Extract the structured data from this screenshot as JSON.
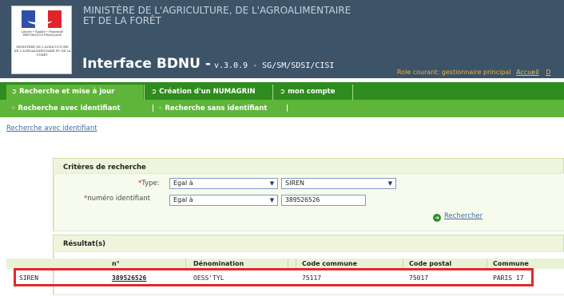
{
  "header": {
    "logo": {
      "republic_text": "Liberté • Égalité • Fraternité RÉPUBLIQUE FRANÇAISE",
      "ministry_text": "MINISTÈRE DE L'AGRICULTURE DE L'AGROALIMENTAIRE ET DE LA FORÊT"
    },
    "ministry_line1": "MINISTÈRE DE L'AGRICULTURE, DE L'AGROALIMENTAIRE",
    "ministry_line2": "ET DE LA FORÊT",
    "app_title": "Interface BDNU -",
    "version": "v.3.0.9 - SG/SM/SDSI/CISI",
    "role": "Role courant: gestionnaire principal",
    "accueil": "Accueil",
    "cut_link": "D"
  },
  "nav": {
    "tabs": [
      {
        "label": "Recherche et mise à jour"
      },
      {
        "label": "Création d'un NUMAGRIN"
      },
      {
        "label": "mon compte"
      }
    ]
  },
  "subnav": {
    "items": [
      {
        "label": "Recherche avec identifiant"
      },
      {
        "label": "Recherche sans identifiant"
      }
    ]
  },
  "breadcrumb": "Recherche avec identifiant",
  "criteria": {
    "title": "Critères de recherche",
    "type_label": "Type:",
    "type_operator": "Egal à",
    "type_value": "SIREN",
    "id_label": "numéro identifiant",
    "id_operator": "Egal à",
    "id_value": "389526526",
    "search_button": "Rechercher"
  },
  "results": {
    "title": "Résultat(s)",
    "columns": [
      "n°",
      "Dénomination",
      "Code commune",
      "Code postal",
      "Commune"
    ],
    "rows": [
      {
        "type": "SIREN",
        "numero": "389526526",
        "denomination": "OESS'TYL",
        "code_commune": "75117",
        "code_postal": "75017",
        "commune": "PARIS 17"
      }
    ]
  },
  "colors": {
    "header_bg": "#3c5368",
    "nav_bg": "#2f8c1e",
    "subnav_bg": "#5fb53a",
    "highlight": "#e3262c"
  }
}
